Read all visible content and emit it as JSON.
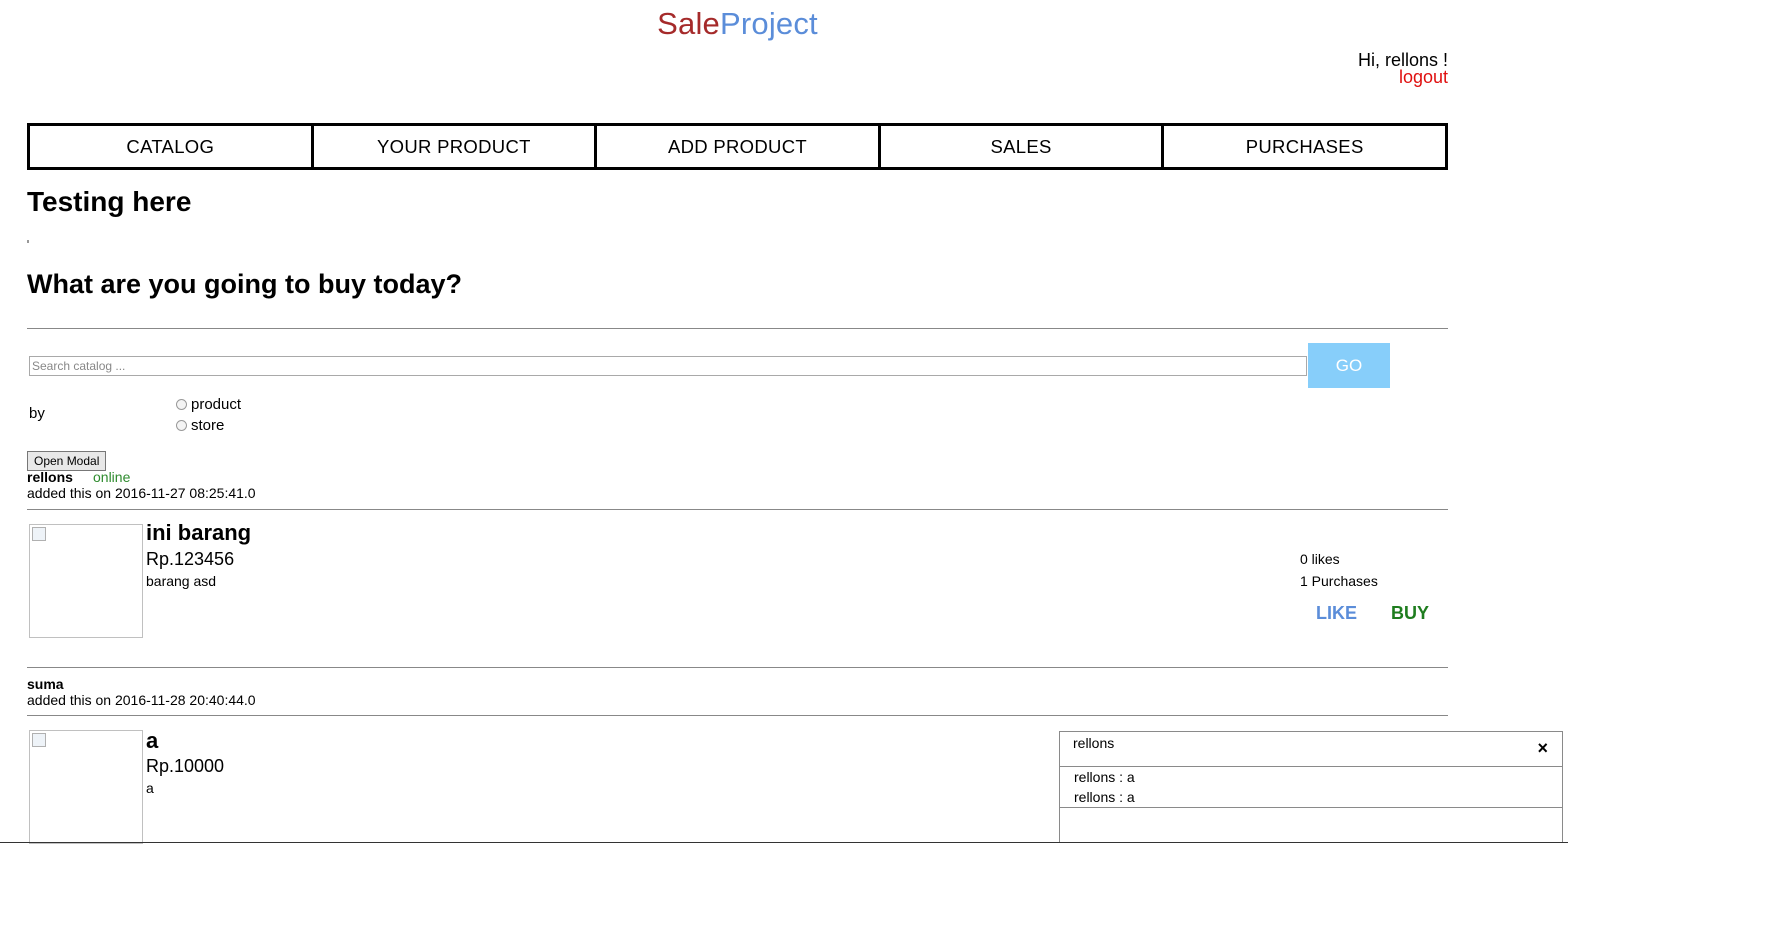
{
  "brand": {
    "part1": "Sale",
    "part2": "Project"
  },
  "user": {
    "greeting": "Hi, rellons !",
    "logout": "logout"
  },
  "nav": {
    "items": [
      "CATALOG",
      "YOUR PRODUCT",
      "ADD PRODUCT",
      "SALES",
      "PURCHASES"
    ]
  },
  "page": {
    "title": "Testing here",
    "subtitle": "What are you going to buy today?"
  },
  "search": {
    "placeholder": "Search catalog ...",
    "go_label": "GO",
    "by_label": "by",
    "options": [
      "product",
      "store"
    ]
  },
  "modal_button": "Open Modal",
  "products": [
    {
      "seller": "rellons",
      "status": "online",
      "added": "added this on 2016-11-27 08:25:41.0",
      "name": "ini barang",
      "price": "Rp.123456",
      "description": "barang asd",
      "likes": "0 likes",
      "purchases": "1 Purchases",
      "like_label": "LIKE",
      "buy_label": "BUY"
    },
    {
      "seller": "suma",
      "added": "added this on 2016-11-28 20:40:44.0",
      "name": "a",
      "price": "Rp.10000",
      "description": "a"
    }
  ],
  "chat": {
    "title": "rellons",
    "close": "×",
    "messages": [
      "rellons : a",
      "rellons : a"
    ]
  },
  "colors": {
    "brand_red": "#a52a2a",
    "brand_blue": "#5b8dd9",
    "go_button": "#87cefa",
    "online": "#2e8b2e",
    "buy": "#1e7d1e",
    "logout": "#e01010"
  }
}
